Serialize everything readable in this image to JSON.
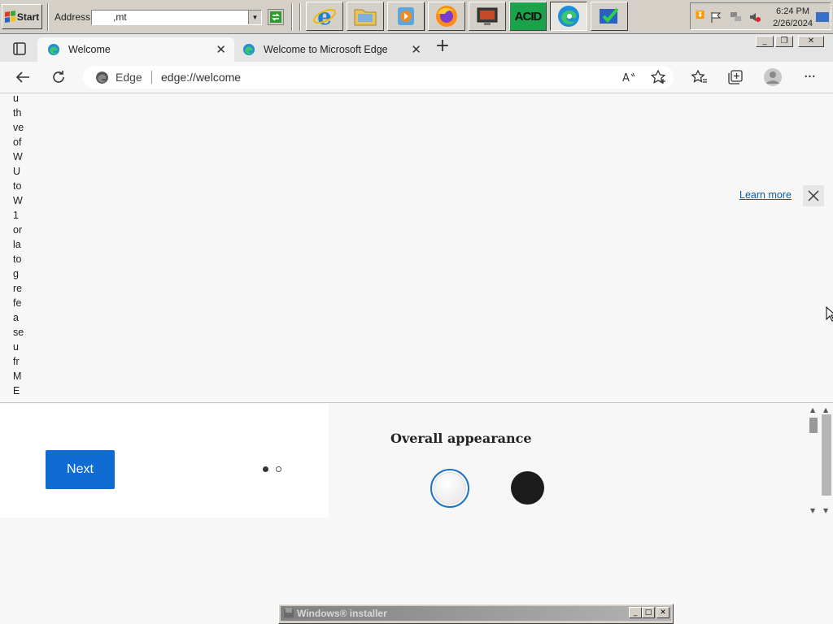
{
  "taskbar": {
    "start_label": "Start",
    "address_label": "Address",
    "address_value": ",mt",
    "quick_launch": [
      "internet-explorer-icon",
      "file-explorer-icon",
      "media-player-icon",
      "firefox-icon",
      "display-settings-icon",
      "acid-icon",
      "edge-icon",
      "checkmark-app-icon"
    ],
    "acid_label": "ACID",
    "tray_icons": [
      "chevron-icon",
      "flag-icon",
      "network-icon",
      "volume-muted-icon"
    ],
    "clock_time": "6:24 PM",
    "clock_date": "2/26/2024"
  },
  "browser": {
    "tabs": [
      {
        "title": "Welcome",
        "active": true
      },
      {
        "title": "Welcome to Microsoft Edge",
        "active": false
      }
    ],
    "site_label": "Edge",
    "url": "edge://welcome"
  },
  "page": {
    "narrow_text": [
      "u",
      "th",
      "ve",
      "of",
      "W",
      "U",
      "to",
      "W",
      "1",
      "or",
      "la",
      "to",
      "g",
      "re",
      "fe",
      "a",
      "se",
      "u",
      "fr",
      "M",
      "E"
    ],
    "learn_more": "Learn more",
    "next_button": "Next",
    "appearance_title": "Overall appearance",
    "carousel_position": 1,
    "carousel_count": 2
  },
  "installer": {
    "title": "Windows® installer"
  },
  "colors": {
    "accent": "#0f6cd3",
    "taskbar": "#d4d0c8",
    "link": "#0b5fa0"
  }
}
